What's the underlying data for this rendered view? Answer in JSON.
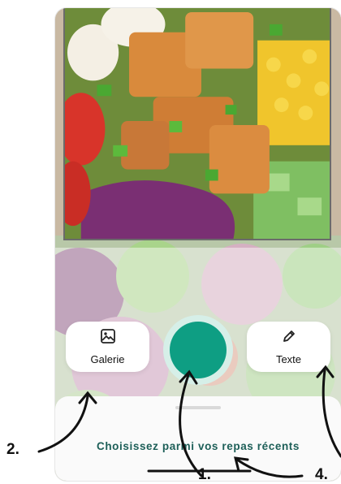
{
  "camera": {
    "gallery_button": {
      "label": "Galerie",
      "icon": "image-icon"
    },
    "text_button": {
      "label": "Texte",
      "icon": "pencil-icon"
    },
    "shutter_color": "#0e9e83",
    "sheet": {
      "title": "Choisissez parmi vos repas récents"
    }
  },
  "annotations": {
    "one": "1.",
    "two": "2.",
    "four": "4."
  }
}
